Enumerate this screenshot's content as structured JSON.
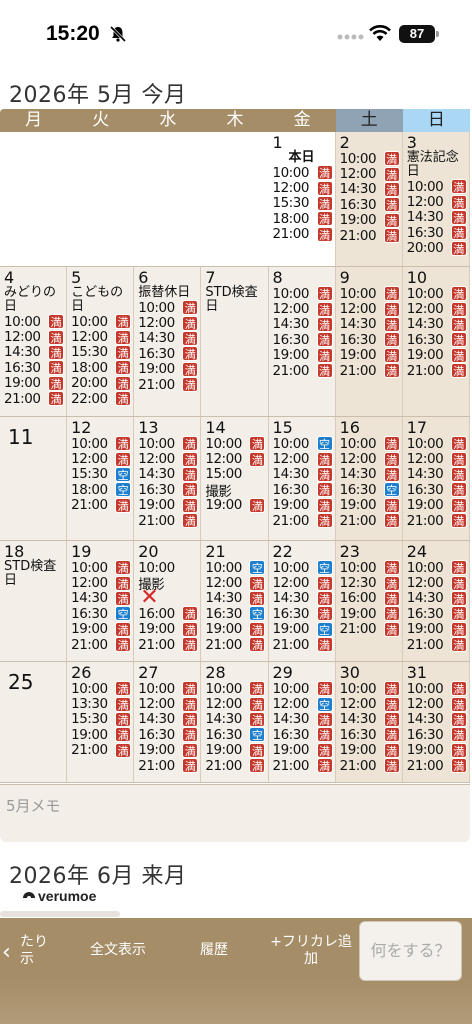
{
  "status_bar": {
    "time": "15:20",
    "battery": "87"
  },
  "current_month_title": "2026年 5月 今月",
  "next_month_title": "2026年 6月 来月",
  "weekdays": [
    "月",
    "火",
    "水",
    "木",
    "金",
    "土",
    "日"
  ],
  "badge_labels": {
    "full": "満",
    "open": "空"
  },
  "memo_placeholder": "5月メモ",
  "logo_text": "verumoe",
  "toolbar": {
    "back_label": "たり示",
    "fulltext_label": "全文表示",
    "history_label": "履歴",
    "furigana_label": "+フリカレ追加",
    "action_label": "何をする？"
  },
  "weeks": [
    {
      "days": [
        {
          "num": "",
          "empty": true
        },
        {
          "num": "",
          "empty": true
        },
        {
          "num": "",
          "empty": true
        },
        {
          "num": "",
          "empty": true
        },
        {
          "num": "1",
          "note": "本日",
          "today": true,
          "slots": [
            [
              "10:00",
              "full"
            ],
            [
              "12:00",
              "full"
            ],
            [
              "15:30",
              "full"
            ],
            [
              "18:00",
              "full"
            ],
            [
              "21:00",
              "full"
            ]
          ]
        },
        {
          "num": "2",
          "slots": [
            [
              "10:00",
              "full"
            ],
            [
              "12:00",
              "full"
            ],
            [
              "14:30",
              "full"
            ],
            [
              "16:30",
              "full"
            ],
            [
              "19:00",
              "full"
            ],
            [
              "21:00",
              "full"
            ]
          ]
        },
        {
          "num": "3",
          "note": "憲法記念日",
          "slots": [
            [
              "10:00",
              "full"
            ],
            [
              "12:00",
              "full"
            ],
            [
              "14:30",
              "full"
            ],
            [
              "16:30",
              "full"
            ],
            [
              "20:00",
              "full"
            ]
          ]
        }
      ]
    },
    {
      "days": [
        {
          "num": "4",
          "note": "みどりの日",
          "slots": [
            [
              "10:00",
              "full"
            ],
            [
              "12:00",
              "full"
            ],
            [
              "14:30",
              "full"
            ],
            [
              "16:30",
              "full"
            ],
            [
              "19:00",
              "full"
            ],
            [
              "21:00",
              "full"
            ]
          ]
        },
        {
          "num": "5",
          "note": "こどもの日",
          "slots": [
            [
              "10:00",
              "full"
            ],
            [
              "12:00",
              "full"
            ],
            [
              "15:30",
              "full"
            ],
            [
              "18:00",
              "full"
            ],
            [
              "20:00",
              "full"
            ],
            [
              "22:00",
              "full"
            ]
          ]
        },
        {
          "num": "6",
          "note": "振替休日",
          "slots": [
            [
              "10:00",
              "full"
            ],
            [
              "12:00",
              "full"
            ],
            [
              "14:30",
              "full"
            ],
            [
              "16:30",
              "full"
            ],
            [
              "19:00",
              "full"
            ],
            [
              "21:00",
              "full"
            ]
          ]
        },
        {
          "num": "7",
          "note": "STD検査日",
          "slots": []
        },
        {
          "num": "8",
          "slots": [
            [
              "10:00",
              "full"
            ],
            [
              "12:00",
              "full"
            ],
            [
              "14:30",
              "full"
            ],
            [
              "16:30",
              "full"
            ],
            [
              "19:00",
              "full"
            ],
            [
              "21:00",
              "full"
            ]
          ]
        },
        {
          "num": "9",
          "slots": [
            [
              "10:00",
              "full"
            ],
            [
              "12:00",
              "full"
            ],
            [
              "14:30",
              "full"
            ],
            [
              "16:30",
              "full"
            ],
            [
              "19:00",
              "full"
            ],
            [
              "21:00",
              "full"
            ]
          ]
        },
        {
          "num": "10",
          "slots": [
            [
              "10:00",
              "full"
            ],
            [
              "12:00",
              "full"
            ],
            [
              "14:30",
              "full"
            ],
            [
              "16:30",
              "full"
            ],
            [
              "19:00",
              "full"
            ],
            [
              "21:00",
              "full"
            ]
          ]
        }
      ]
    },
    {
      "days": [
        {
          "num": "11",
          "big": true,
          "slots": []
        },
        {
          "num": "12",
          "slots": [
            [
              "10:00",
              "full"
            ],
            [
              "12:00",
              "full"
            ],
            [
              "15:30",
              "open"
            ],
            [
              "18:00",
              "open"
            ],
            [
              "21:00",
              "full"
            ]
          ]
        },
        {
          "num": "13",
          "slots": [
            [
              "10:00",
              "full"
            ],
            [
              "12:00",
              "full"
            ],
            [
              "14:30",
              "full"
            ],
            [
              "16:30",
              "full"
            ],
            [
              "19:00",
              "full"
            ],
            [
              "21:00",
              "full"
            ]
          ]
        },
        {
          "num": "14",
          "slots": [
            [
              "10:00",
              "full"
            ],
            [
              "12:00",
              "full"
            ],
            [
              "15:00",
              ""
            ],
            [
              "撮影",
              ""
            ],
            [
              "19:00",
              "full"
            ]
          ]
        },
        {
          "num": "15",
          "slots": [
            [
              "10:00",
              "open"
            ],
            [
              "12:00",
              "full"
            ],
            [
              "14:30",
              "full"
            ],
            [
              "16:30",
              "full"
            ],
            [
              "19:00",
              "full"
            ],
            [
              "21:00",
              "full"
            ]
          ]
        },
        {
          "num": "16",
          "slots": [
            [
              "10:00",
              "full"
            ],
            [
              "12:00",
              "full"
            ],
            [
              "14:30",
              "full"
            ],
            [
              "16:30",
              "open"
            ],
            [
              "19:00",
              "full"
            ],
            [
              "21:00",
              "full"
            ]
          ]
        },
        {
          "num": "17",
          "slots": [
            [
              "10:00",
              "full"
            ],
            [
              "12:00",
              "full"
            ],
            [
              "14:30",
              "full"
            ],
            [
              "16:30",
              "full"
            ],
            [
              "19:00",
              "full"
            ],
            [
              "21:00",
              "full"
            ]
          ]
        }
      ]
    },
    {
      "days": [
        {
          "num": "18",
          "note": "STD検査日",
          "slots": []
        },
        {
          "num": "19",
          "slots": [
            [
              "10:00",
              "full"
            ],
            [
              "12:00",
              "full"
            ],
            [
              "14:30",
              "full"
            ],
            [
              "16:30",
              "open"
            ],
            [
              "19:00",
              "full"
            ],
            [
              "21:00",
              "full"
            ]
          ]
        },
        {
          "num": "20",
          "slots": [
            [
              "10:00",
              ""
            ],
            [
              "撮影",
              ""
            ],
            [
              "X",
              ""
            ],
            [
              "16:00",
              "full"
            ],
            [
              "19:00",
              "full"
            ],
            [
              "21:00",
              "full"
            ]
          ]
        },
        {
          "num": "21",
          "slots": [
            [
              "10:00",
              "open"
            ],
            [
              "12:00",
              "full"
            ],
            [
              "14:30",
              "full"
            ],
            [
              "16:30",
              "open"
            ],
            [
              "19:00",
              "full"
            ],
            [
              "21:00",
              "full"
            ]
          ]
        },
        {
          "num": "22",
          "slots": [
            [
              "10:00",
              "open"
            ],
            [
              "12:00",
              "full"
            ],
            [
              "14:30",
              "full"
            ],
            [
              "16:30",
              "full"
            ],
            [
              "19:00",
              "open"
            ],
            [
              "21:00",
              "full"
            ]
          ]
        },
        {
          "num": "23",
          "slots": [
            [
              "10:00",
              "full"
            ],
            [
              "12:30",
              "full"
            ],
            [
              "16:00",
              "full"
            ],
            [
              "19:00",
              "full"
            ],
            [
              "21:00",
              "full"
            ]
          ]
        },
        {
          "num": "24",
          "slots": [
            [
              "10:00",
              "full"
            ],
            [
              "12:00",
              "full"
            ],
            [
              "14:30",
              "full"
            ],
            [
              "16:30",
              "full"
            ],
            [
              "19:00",
              "full"
            ],
            [
              "21:00",
              "full"
            ]
          ]
        }
      ]
    },
    {
      "days": [
        {
          "num": "25",
          "big": true,
          "slots": []
        },
        {
          "num": "26",
          "slots": [
            [
              "10:00",
              "full"
            ],
            [
              "13:30",
              "full"
            ],
            [
              "15:30",
              "full"
            ],
            [
              "19:00",
              "full"
            ],
            [
              "21:00",
              "full"
            ]
          ]
        },
        {
          "num": "27",
          "slots": [
            [
              "10:00",
              "full"
            ],
            [
              "12:00",
              "full"
            ],
            [
              "14:30",
              "full"
            ],
            [
              "16:30",
              "full"
            ],
            [
              "19:00",
              "full"
            ],
            [
              "21:00",
              "full"
            ]
          ]
        },
        {
          "num": "28",
          "slots": [
            [
              "10:00",
              "full"
            ],
            [
              "12:00",
              "full"
            ],
            [
              "14:30",
              "full"
            ],
            [
              "16:30",
              "open"
            ],
            [
              "19:00",
              "full"
            ],
            [
              "21:00",
              "full"
            ]
          ]
        },
        {
          "num": "29",
          "slots": [
            [
              "10:00",
              "full"
            ],
            [
              "12:00",
              "open"
            ],
            [
              "14:30",
              "full"
            ],
            [
              "16:30",
              "full"
            ],
            [
              "19:00",
              "full"
            ],
            [
              "21:00",
              "full"
            ]
          ]
        },
        {
          "num": "30",
          "slots": [
            [
              "10:00",
              "full"
            ],
            [
              "12:00",
              "full"
            ],
            [
              "14:30",
              "full"
            ],
            [
              "16:30",
              "full"
            ],
            [
              "19:00",
              "full"
            ],
            [
              "21:00",
              "full"
            ]
          ]
        },
        {
          "num": "31",
          "slots": [
            [
              "10:00",
              "full"
            ],
            [
              "12:00",
              "full"
            ],
            [
              "14:30",
              "full"
            ],
            [
              "16:30",
              "full"
            ],
            [
              "19:00",
              "full"
            ],
            [
              "21:00",
              "full"
            ]
          ]
        }
      ]
    }
  ]
}
